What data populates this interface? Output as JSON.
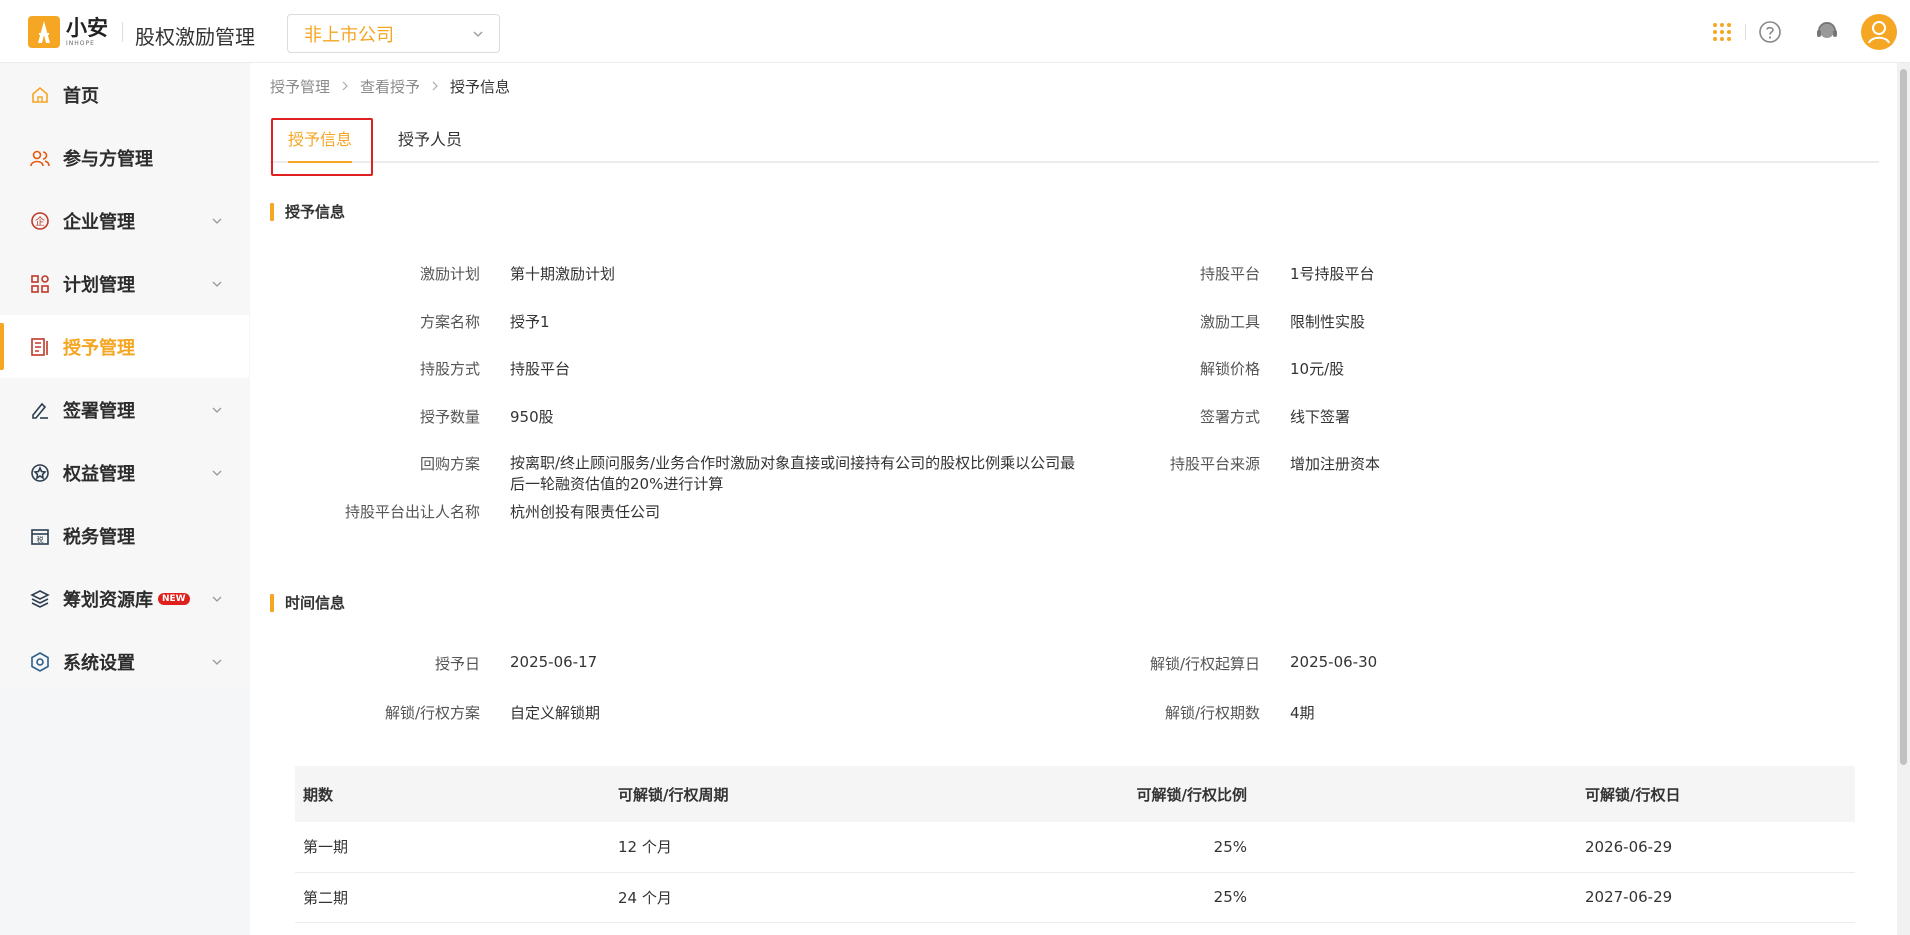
{
  "header": {
    "logo_cn": "小安",
    "logo_en": "INHOPE",
    "app_title": "股权激励管理",
    "company_select": "非上市公司",
    "icons": [
      "apps-grid-icon",
      "help-icon",
      "customer-service-icon",
      "user-avatar-icon"
    ]
  },
  "sidebar": {
    "items": [
      {
        "label": "首页",
        "icon": "home-icon"
      },
      {
        "label": "参与方管理",
        "icon": "users-icon"
      },
      {
        "label": "企业管理",
        "icon": "enterprise-icon",
        "expandable": true
      },
      {
        "label": "计划管理",
        "icon": "plan-icon",
        "expandable": true
      },
      {
        "label": "授予管理",
        "icon": "grant-icon",
        "active": true
      },
      {
        "label": "签署管理",
        "icon": "sign-icon",
        "expandable": true
      },
      {
        "label": "权益管理",
        "icon": "equity-icon",
        "expandable": true
      },
      {
        "label": "税务管理",
        "icon": "tax-icon"
      },
      {
        "label": "筹划资源库",
        "icon": "layers-icon",
        "badge": "NEW",
        "expandable": true
      },
      {
        "label": "系统设置",
        "icon": "settings-icon",
        "expandable": true
      }
    ]
  },
  "breadcrumb": [
    "授予管理",
    "查看授予",
    "授予信息"
  ],
  "tabs": [
    {
      "label": "授予信息",
      "active": true
    },
    {
      "label": "授予人员",
      "active": false
    }
  ],
  "grant_section": {
    "title": "授予信息",
    "left": [
      {
        "label": "激励计划",
        "value": "第十期激励计划"
      },
      {
        "label": "方案名称",
        "value": "授予1"
      },
      {
        "label": "持股方式",
        "value": "持股平台"
      },
      {
        "label": "授予数量",
        "value": "950股"
      },
      {
        "label": "回购方案",
        "value": "按离职/终止顾问服务/业务合作时激励对象直接或间接持有公司的股权比例乘以公司最后一轮融资估值的20%进行计算"
      },
      {
        "label": "持股平台出让人名称",
        "value": "杭州创投有限责任公司"
      }
    ],
    "right": [
      {
        "label": "持股平台",
        "value": "1号持股平台"
      },
      {
        "label": "激励工具",
        "value": "限制性实股"
      },
      {
        "label": "解锁价格",
        "value": "10元/股"
      },
      {
        "label": "签署方式",
        "value": "线下签署"
      },
      {
        "label": "持股平台来源",
        "value": "增加注册资本"
      }
    ]
  },
  "time_section": {
    "title": "时间信息",
    "left": [
      {
        "label": "授予日",
        "value": "2025-06-17"
      },
      {
        "label": "解锁/行权方案",
        "value": "自定义解锁期"
      }
    ],
    "right": [
      {
        "label": "解锁/行权起算日",
        "value": "2025-06-30"
      },
      {
        "label": "解锁/行权期数",
        "value": "4期"
      }
    ]
  },
  "period_table": {
    "columns": [
      "期数",
      "可解锁/行权周期",
      "可解锁/行权比例",
      "可解锁/行权日"
    ],
    "rows": [
      [
        "第一期",
        "12 个月",
        "25%",
        "2026-06-29"
      ],
      [
        "第二期",
        "24 个月",
        "25%",
        "2027-06-29"
      ]
    ]
  },
  "colors": {
    "accent": "#f5a623",
    "highlight_box": "#e02020",
    "badge": "#e0201c"
  }
}
